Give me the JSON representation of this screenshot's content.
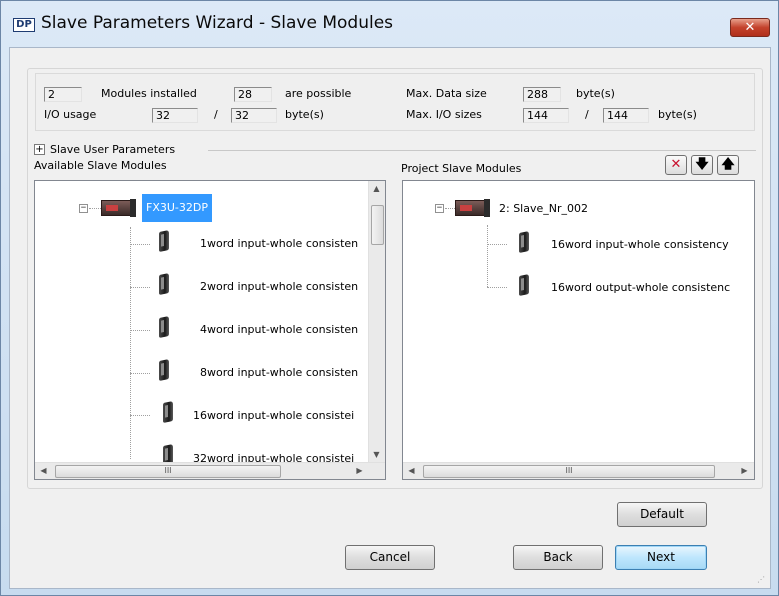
{
  "window": {
    "title": "Slave Parameters Wizard - Slave Modules",
    "icon_text": "DP",
    "close_label": "✕"
  },
  "summary": {
    "modules_installed_value": "2",
    "modules_installed_label": "Modules installed",
    "possible_value": "28",
    "possible_label": "are possible",
    "max_data_size_label": "Max. Data size",
    "max_data_size_value": "288",
    "bytes_label": "byte(s)",
    "io_usage_label": "I/O usage",
    "io_usage_in": "32",
    "io_usage_sep": "/",
    "io_usage_out": "32",
    "io_bytes_label": "byte(s)",
    "max_io_sizes_label": "Max. I/O sizes",
    "max_io_in": "144",
    "max_io_sep": "/",
    "max_io_out": "144",
    "max_io_bytes_label": "byte(s)"
  },
  "slave_user_parameters": {
    "label": "Slave User Parameters",
    "expander": "+"
  },
  "available": {
    "header": "Available Slave Modules",
    "root_label": "FX3U-32DP",
    "items": [
      "1word input-whole consisten",
      "2word input-whole consisten",
      "4word input-whole consisten",
      "8word input-whole consisten",
      "16word input-whole consistei",
      "32word input-whole consistei"
    ],
    "hscroll_thumb": "III"
  },
  "project": {
    "header": "Project Slave Modules",
    "root_label": "2: Slave_Nr_002",
    "items": [
      "16word input-whole consistency",
      "16word output-whole consistenc"
    ],
    "hscroll_thumb": "III",
    "toolbar": {
      "delete_icon": "✕",
      "down_icon": "🡇",
      "up_icon": "🡅"
    }
  },
  "buttons": {
    "default": "Default",
    "cancel": "Cancel",
    "back": "Back",
    "next": "Next"
  },
  "colors": {
    "selection": "#3399ff",
    "primary_button": "#bee6fd",
    "close_button": "#c4422c"
  }
}
